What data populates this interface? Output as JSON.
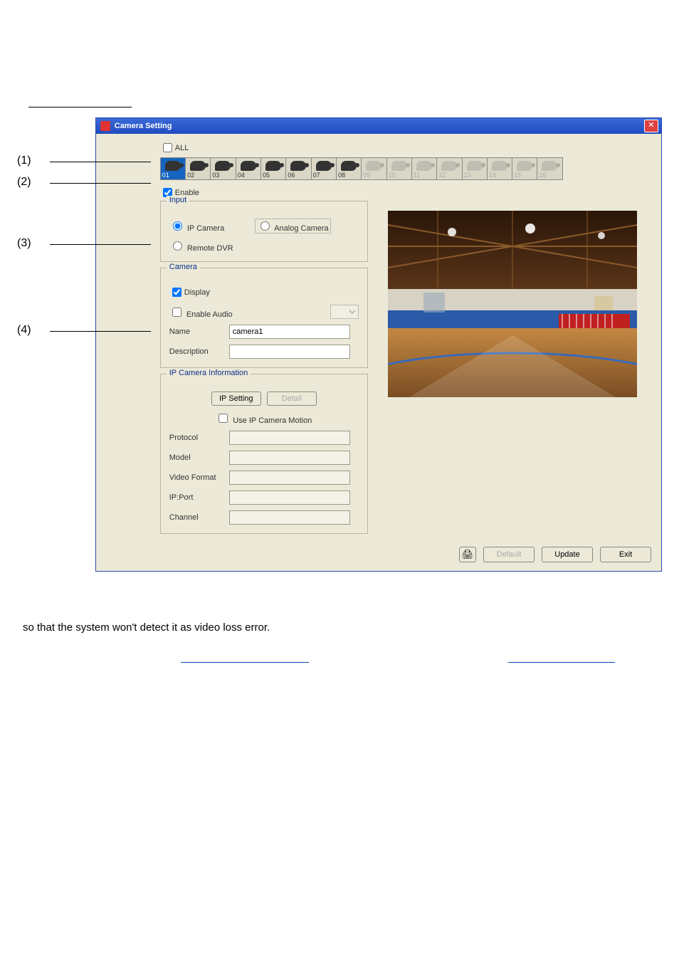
{
  "dialog": {
    "title": "Camera Setting",
    "all_label": "ALL",
    "enable_label": "Enable",
    "cameras": [
      {
        "num": "01",
        "state": "active"
      },
      {
        "num": "02",
        "state": "on"
      },
      {
        "num": "03",
        "state": "on"
      },
      {
        "num": "04",
        "state": "on"
      },
      {
        "num": "05",
        "state": "on"
      },
      {
        "num": "06",
        "state": "on"
      },
      {
        "num": "07",
        "state": "on"
      },
      {
        "num": "08",
        "state": "on"
      },
      {
        "num": "09",
        "state": "disabled"
      },
      {
        "num": "10",
        "state": "disabled"
      },
      {
        "num": "11",
        "state": "disabled"
      },
      {
        "num": "12",
        "state": "disabled"
      },
      {
        "num": "13",
        "state": "disabled"
      },
      {
        "num": "14",
        "state": "disabled"
      },
      {
        "num": "15",
        "state": "disabled"
      },
      {
        "num": "16",
        "state": "disabled"
      }
    ],
    "input_group": {
      "title": "Input",
      "ip_camera": "IP Camera",
      "analog_camera": "Analog Camera",
      "remote_dvr": "Remote DVR"
    },
    "camera_group": {
      "title": "Camera",
      "display": "Display",
      "enable_audio": "Enable Audio",
      "name_label": "Name",
      "name_value": "camera1",
      "desc_label": "Description",
      "desc_value": ""
    },
    "ipinfo_group": {
      "title": "IP Camera Information",
      "ip_setting_btn": "IP Setting",
      "detail_btn": "Detail",
      "use_motion": "Use IP Camera Motion",
      "fields": {
        "protocol": {
          "label": "Protocol",
          "value": ""
        },
        "model": {
          "label": "Model",
          "value": ""
        },
        "video_format": {
          "label": "Video Format",
          "value": ""
        },
        "ip_port": {
          "label": "IP:Port",
          "value": ""
        },
        "channel": {
          "label": "Channel",
          "value": ""
        }
      }
    },
    "footer": {
      "default_btn": "Default",
      "update_btn": "Update",
      "exit_btn": "Exit"
    }
  },
  "callouts": {
    "c1": "(1)",
    "c2": "(2)",
    "c3": "(3)",
    "c4": "(4)"
  },
  "body_text": "so that the system won't detect it as video loss error."
}
